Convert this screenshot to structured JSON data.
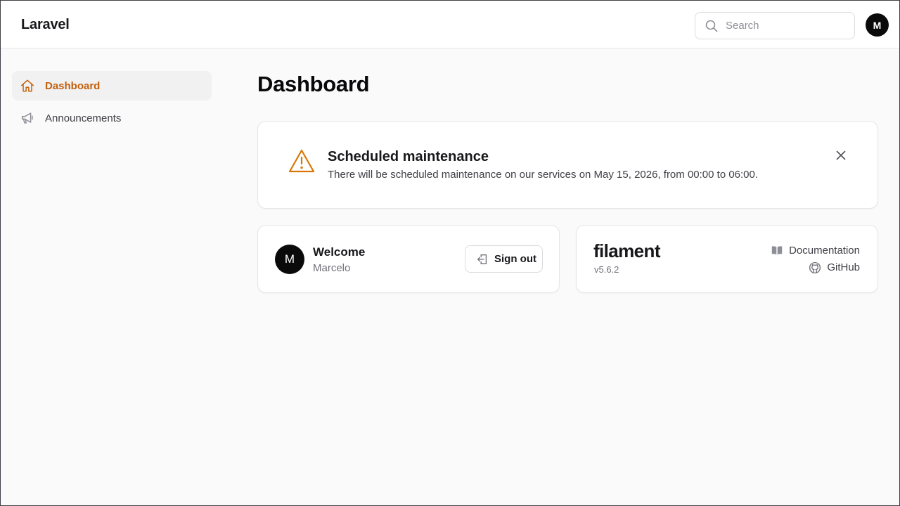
{
  "topbar": {
    "brand": "Laravel",
    "search": {
      "placeholder": "Search",
      "value": ""
    },
    "user_initial": "M"
  },
  "sidebar": {
    "items": [
      {
        "label": "Dashboard",
        "icon": "home-icon",
        "active": true
      },
      {
        "label": "Announcements",
        "icon": "megaphone-icon",
        "active": false
      }
    ]
  },
  "main": {
    "title": "Dashboard",
    "alert": {
      "title": "Scheduled maintenance",
      "body": "There will be scheduled maintenance on our services on May 15, 2026, from 00:00 to 06:00.",
      "icon": "warning-icon"
    },
    "welcome": {
      "avatar_initial": "M",
      "heading": "Welcome",
      "user_name": "Marcelo",
      "sign_out_label": "Sign out"
    },
    "filament": {
      "logo_text": "filament",
      "version": "v5.6.2",
      "documentation_label": "Documentation",
      "github_label": "GitHub"
    }
  },
  "colors": {
    "accent": "#c2610c",
    "background": "#fafafa",
    "card": "#ffffff",
    "avatar": "#0a0a0a"
  }
}
